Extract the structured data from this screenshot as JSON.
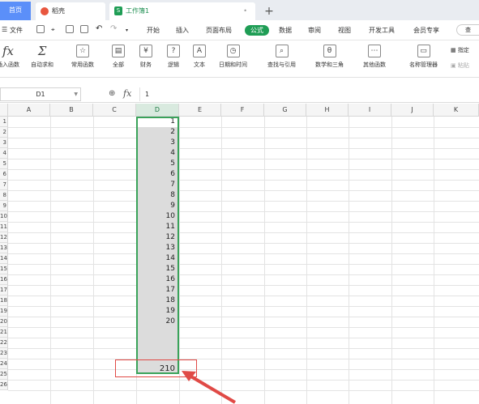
{
  "tabs": {
    "home": "首页",
    "daoke": "稻壳",
    "workbook": "工作簿1",
    "workbook_dot": "•",
    "plus": "+"
  },
  "menu": {
    "file": "文件",
    "items": [
      "开始",
      "插入",
      "页面布局",
      "公式",
      "数据",
      "审阅",
      "视图",
      "开发工具",
      "会员专享"
    ],
    "active": "公式",
    "search": "查"
  },
  "ribbon": {
    "insert_fn": "插入函数",
    "autosum": "自动求和",
    "common_fn": "常用函数",
    "all": "全部",
    "finance": "财务",
    "logic": "逻辑",
    "text": "文本",
    "datetime": "日期和时间",
    "lookup": "查找与引用",
    "math": "数学和三角",
    "other": "其他函数",
    "name_mgr": "名称管理器",
    "paste": "粘贴",
    "specify": "指定",
    "fx_symbol": "fx",
    "sigma_symbol": "Σ"
  },
  "formula_bar": {
    "name_box": "D1",
    "fx": "fx",
    "value": "1"
  },
  "columns": [
    "A",
    "B",
    "C",
    "D",
    "E",
    "F",
    "G",
    "H",
    "I",
    "J",
    "K"
  ],
  "rows": [
    "1",
    "2",
    "3",
    "4",
    "5",
    "6",
    "7",
    "8",
    "9",
    "10",
    "11",
    "12",
    "13",
    "14",
    "15",
    "16",
    "17",
    "18",
    "19",
    "20",
    "21",
    "22",
    "23",
    "24",
    "25",
    "26"
  ],
  "cells_d": [
    "1",
    "2",
    "3",
    "4",
    "5",
    "6",
    "7",
    "8",
    "9",
    "10",
    "11",
    "12",
    "13",
    "14",
    "15",
    "16",
    "17",
    "18",
    "19",
    "20"
  ],
  "sum_cell": "210",
  "colors": {
    "accent": "#1f9d55",
    "selection_border": "#3aa35a",
    "highlight": "#e04a46",
    "home_tab": "#5b8ff9"
  }
}
